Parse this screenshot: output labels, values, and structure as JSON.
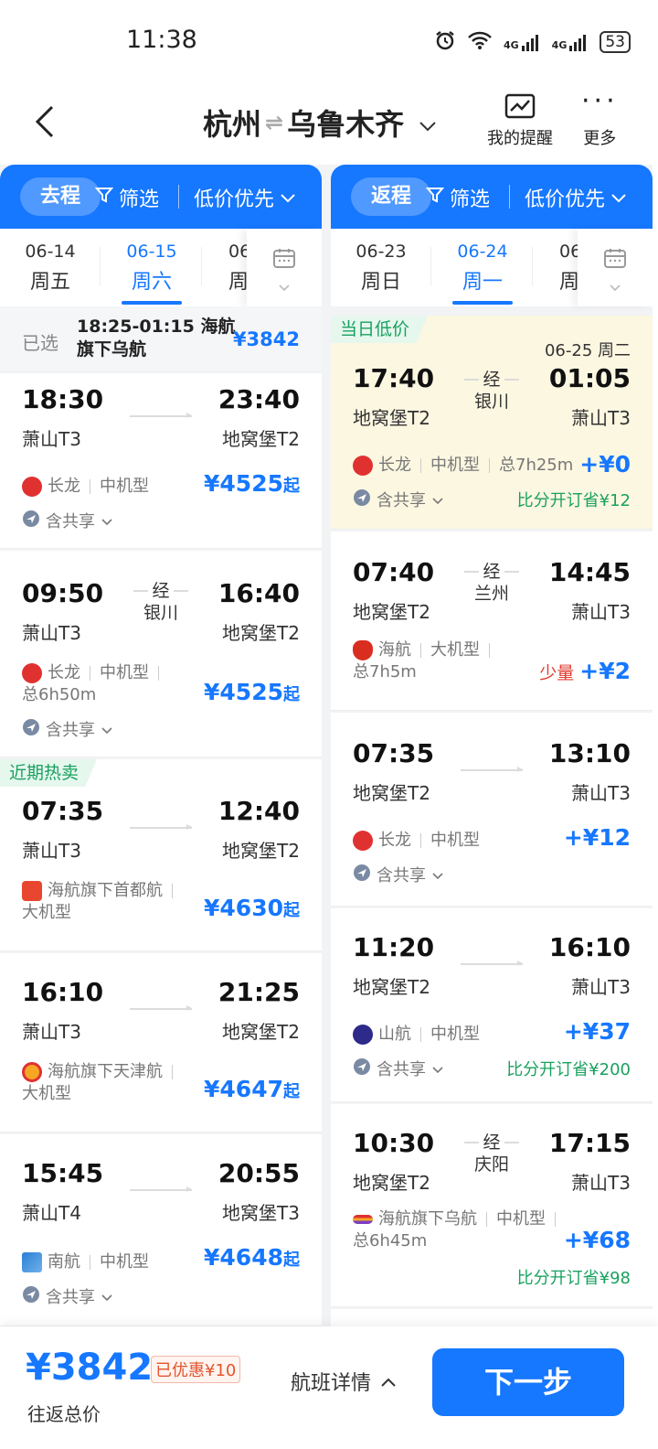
{
  "status": {
    "time": "11:38",
    "net1": "4G",
    "net2": "4G",
    "battery": "53"
  },
  "header": {
    "from": "杭州",
    "to": "乌鲁木齐",
    "swap_icon": "⇌",
    "reminder": "我的提醒",
    "more": "更多"
  },
  "outbound": {
    "tab": "去程",
    "filter": "筛选",
    "sort": "低价优先",
    "dates": [
      {
        "date": "06-14",
        "day": "周五"
      },
      {
        "date": "06-15",
        "day": "周六"
      },
      {
        "date": "06",
        "day": "周"
      }
    ],
    "selected": {
      "label": "已选",
      "info": "18:25-01:15 海航旗下乌航",
      "price": "¥3842"
    },
    "flights": [
      {
        "dep": "18:30",
        "arr": "23:40",
        "from": "萧山T3",
        "to": "地窝堡T2",
        "airline": "长龙",
        "plane": "中机型",
        "price": "¥4525",
        "qi": "起",
        "share": "含共享"
      },
      {
        "dep": "09:50",
        "arr": "16:40",
        "from": "萧山T3",
        "to": "地窝堡T2",
        "via": "经",
        "via_city": "银川",
        "airline": "长龙",
        "plane": "中机型",
        "duration": "总6h50m",
        "price": "¥4525",
        "qi": "起",
        "share": "含共享"
      },
      {
        "tag": "近期热卖",
        "dep": "07:35",
        "arr": "12:40",
        "from": "萧山T3",
        "to": "地窝堡T2",
        "airline": "海航旗下首都航",
        "plane": "大机型",
        "price": "¥4630",
        "qi": "起"
      },
      {
        "dep": "16:10",
        "arr": "21:25",
        "from": "萧山T3",
        "to": "地窝堡T2",
        "airline": "海航旗下天津航",
        "plane": "大机型",
        "price": "¥4647",
        "qi": "起"
      },
      {
        "dep": "15:45",
        "arr": "20:55",
        "from": "萧山T4",
        "to": "地窝堡T3",
        "airline": "南航",
        "plane": "中机型",
        "price": "¥4648",
        "qi": "起",
        "share": "含共享"
      }
    ]
  },
  "return": {
    "tab": "返程",
    "filter": "筛选",
    "sort": "低价优先",
    "dates": [
      {
        "date": "06-23",
        "day": "周日"
      },
      {
        "date": "06-24",
        "day": "周一"
      },
      {
        "date": "06",
        "day": "周"
      }
    ],
    "flights": [
      {
        "tag": "当日低价",
        "next_date": "06-25 周二",
        "dep": "17:40",
        "arr": "01:05",
        "from": "地窝堡T2",
        "to": "萧山T3",
        "via": "经",
        "via_city": "银川",
        "airline": "长龙",
        "plane": "中机型",
        "duration": "总7h25m",
        "price": "+¥0",
        "share": "含共享",
        "save": "比分开订省¥12"
      },
      {
        "dep": "07:40",
        "arr": "14:45",
        "from": "地窝堡T2",
        "to": "萧山T3",
        "via": "经",
        "via_city": "兰州",
        "airline": "海航",
        "plane": "大机型",
        "duration": "总7h5m",
        "few": "少量",
        "price": "+¥2"
      },
      {
        "dep": "07:35",
        "arr": "13:10",
        "from": "地窝堡T2",
        "to": "萧山T3",
        "airline": "长龙",
        "plane": "中机型",
        "price": "+¥12",
        "share": "含共享"
      },
      {
        "dep": "11:20",
        "arr": "16:10",
        "from": "地窝堡T2",
        "to": "萧山T3",
        "airline": "山航",
        "plane": "中机型",
        "price": "+¥37",
        "share": "含共享",
        "save": "比分开订省¥200"
      },
      {
        "dep": "10:30",
        "arr": "17:15",
        "from": "地窝堡T2",
        "to": "萧山T3",
        "via": "经",
        "via_city": "庆阳",
        "airline": "海航旗下乌航",
        "plane": "中机型",
        "duration": "总6h45m",
        "price": "+¥68",
        "save": "比分开订省¥98"
      }
    ]
  },
  "bottom": {
    "total": "¥3842",
    "discount": "已优惠¥10",
    "total_label": "往返总价",
    "detail": "航班详情",
    "next": "下一步"
  },
  "colors": {
    "primary": "#1677ff",
    "green": "#19a15f",
    "red": "#e23b2e",
    "highlight": "#fcf7e1"
  }
}
